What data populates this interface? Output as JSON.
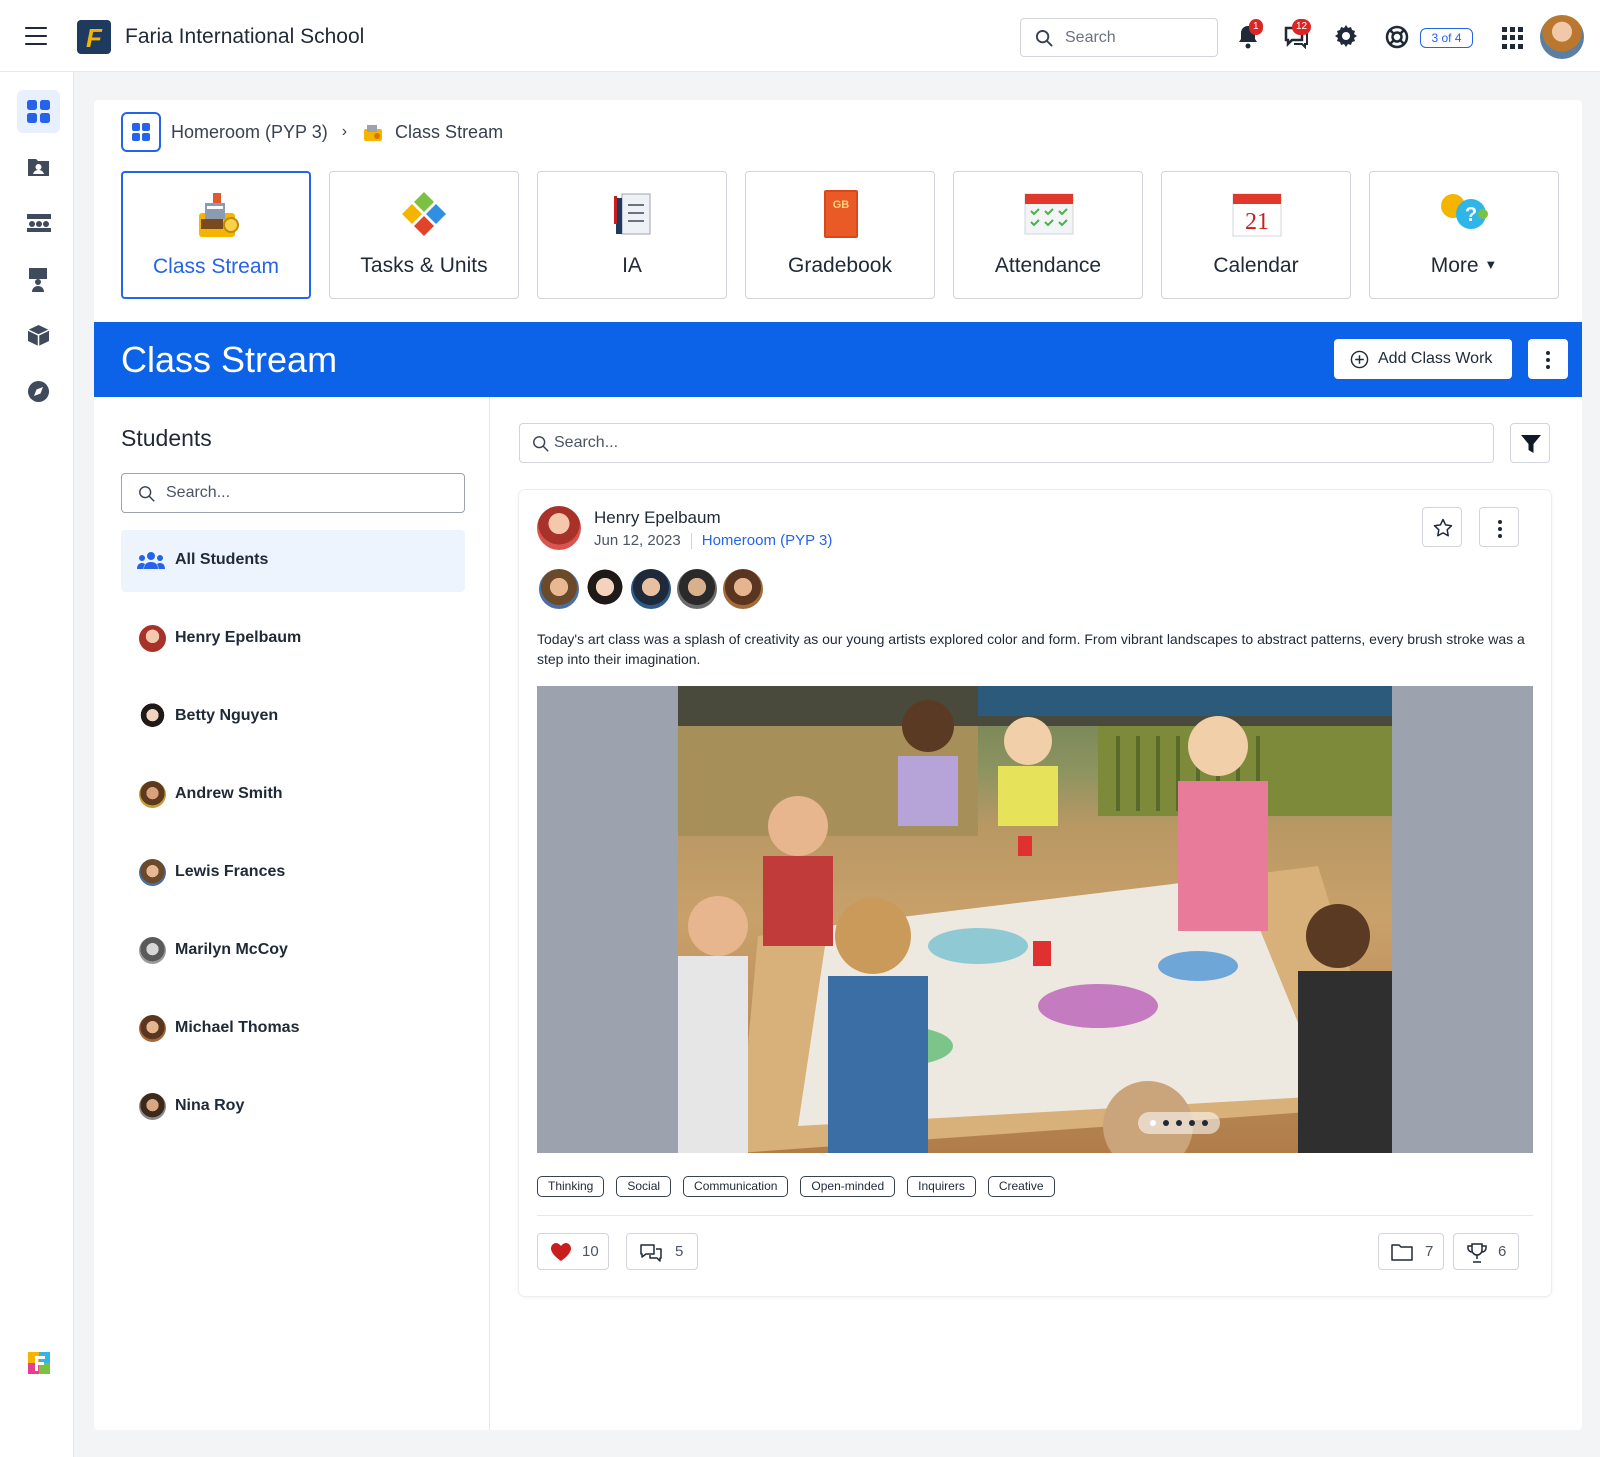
{
  "header": {
    "school_name": "Faria International School",
    "search_placeholder": "Search",
    "notification_count": "1",
    "message_count": "12",
    "tour_progress": "3 of 4"
  },
  "breadcrumb": {
    "parent": "Homeroom (PYP 3)",
    "current": "Class Stream"
  },
  "tiles": [
    {
      "label": "Class Stream",
      "icon": "class-stream-icon"
    },
    {
      "label": "Tasks & Units",
      "icon": "puzzle-icon"
    },
    {
      "label": "IA",
      "icon": "ia-icon"
    },
    {
      "label": "Gradebook",
      "icon": "gradebook-icon"
    },
    {
      "label": "Attendance",
      "icon": "attendance-icon"
    },
    {
      "label": "Calendar",
      "icon": "calendar-icon"
    },
    {
      "label": "More",
      "icon": "more-icon"
    }
  ],
  "tile_extras": {
    "gradebook_cover": "GB",
    "calendar_day": "21"
  },
  "banner": {
    "title": "Class Stream",
    "add_button": "Add Class Work"
  },
  "students": {
    "title": "Students",
    "search_placeholder": "Search...",
    "all_label": "All Students",
    "items": [
      {
        "name": "Henry Epelbaum"
      },
      {
        "name": "Betty Nguyen"
      },
      {
        "name": "Andrew Smith"
      },
      {
        "name": "Lewis Frances"
      },
      {
        "name": "Marilyn McCoy"
      },
      {
        "name": "Michael Thomas"
      },
      {
        "name": "Nina Roy"
      }
    ]
  },
  "feed": {
    "search_placeholder": "Search..."
  },
  "post": {
    "author": "Henry Epelbaum",
    "date": "Jun 12, 2023",
    "class_link": "Homeroom (PYP 3)",
    "text": "Today's art class was a splash of creativity as our young artists explored color and form. From vibrant landscapes to abstract patterns, every brush stroke was a step into their imagination.",
    "tags": [
      "Thinking",
      "Social",
      "Communication",
      "Open-minded",
      "Inquirers",
      "Creative"
    ],
    "likes": "10",
    "comments": "5",
    "folders": "7",
    "awards": "6"
  },
  "colors": {
    "accent": "#0d63e8",
    "link": "#2563eb",
    "badge": "#dc2626",
    "heart": "#c81e1e"
  }
}
